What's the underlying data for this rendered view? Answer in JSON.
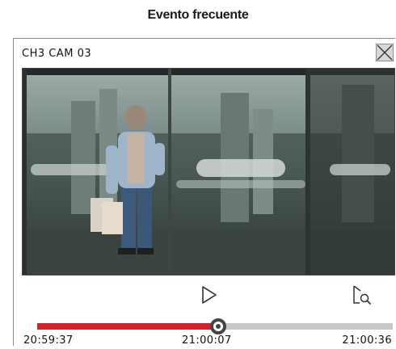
{
  "page": {
    "heading": "Evento frecuente"
  },
  "dialog": {
    "title": "CH3 CAM 03",
    "close_icon": "close-icon"
  },
  "player": {
    "controls": {
      "play_icon": "play-icon",
      "search_icon": "search-icon"
    },
    "timeline": {
      "start_time": "20:59:37",
      "current_time": "21:00:07",
      "end_time": "21:00:36",
      "progress_fraction": 0.51,
      "played_color": "#d2232a",
      "remaining_color": "#c8c8c8"
    }
  }
}
